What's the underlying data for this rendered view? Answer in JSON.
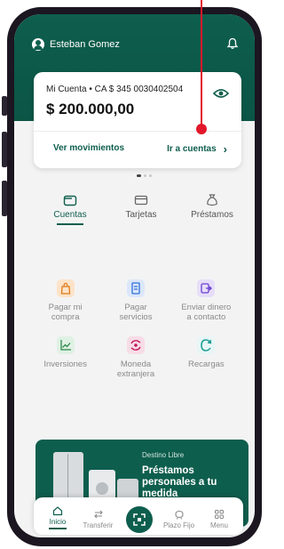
{
  "colors": {
    "brand": "#0e5e4d",
    "annotation": "#e2172b"
  },
  "header": {
    "user_name": "Esteban Gomez",
    "bell_icon": "bell-icon"
  },
  "account_card": {
    "account_label": "Mi Cuenta •  CA $ 345 0030402504",
    "balance": "$ 200.000,00",
    "eye_icon": "eye-icon",
    "link_movements": "Ver movimientos",
    "link_accounts": "Ir a cuentas"
  },
  "tabs": [
    {
      "label": "Cuentas",
      "icon": "wallet-icon",
      "active": true
    },
    {
      "label": "Tarjetas",
      "icon": "card-icon",
      "active": false
    },
    {
      "label": "Préstamos",
      "icon": "money-bag-icon",
      "active": false
    }
  ],
  "actions": [
    {
      "line1": "Pagar mi",
      "line2": "compra",
      "icon": "shopping-bag-icon",
      "color": "#fde3c8"
    },
    {
      "line1": "Pagar",
      "line2": "servicios",
      "icon": "bill-icon",
      "color": "#dbe7fb"
    },
    {
      "line1": "Enviar dinero",
      "line2": "a contacto",
      "icon": "send-money-icon",
      "color": "#e6def9"
    },
    {
      "line1": "Inversiones",
      "line2": "",
      "icon": "chart-icon",
      "color": "#dff1e3"
    },
    {
      "line1": "Moneda",
      "line2": "extranjera",
      "icon": "currency-exchange-icon",
      "color": "#f8dce6"
    },
    {
      "line1": "Recargas",
      "line2": "",
      "icon": "refresh-icon",
      "color": "#e7f6f5"
    }
  ],
  "promo": {
    "tag": "Destino Libre",
    "title": "Préstamos personales a tu medida"
  },
  "bottom_nav": [
    {
      "label": "Inicio",
      "icon": "home-icon",
      "active": true
    },
    {
      "label": "Transferir",
      "icon": "transfer-icon",
      "active": false
    },
    {
      "label": "Plazo Fijo",
      "icon": "savings-icon",
      "active": false
    },
    {
      "label": "Menu",
      "icon": "grid-menu-icon",
      "active": false
    }
  ]
}
